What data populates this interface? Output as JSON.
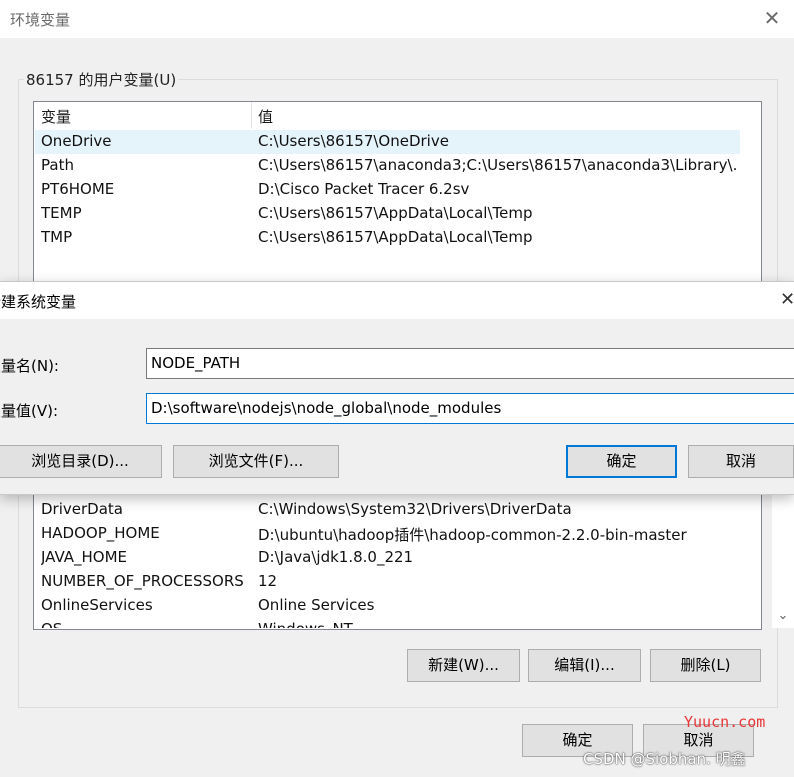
{
  "env_window": {
    "title": "环境变量",
    "close_glyph": "✕",
    "user_group_label": "86157 的用户变量(U)",
    "columns": {
      "name": "变量",
      "value": "值"
    },
    "user_vars": [
      {
        "name": "OneDrive",
        "value": "C:\\Users\\86157\\OneDrive",
        "selected": true
      },
      {
        "name": "Path",
        "value": "C:\\Users\\86157\\anaconda3;C:\\Users\\86157\\anaconda3\\Library\\..."
      },
      {
        "name": "PT6HOME",
        "value": "D:\\Cisco Packet Tracer 6.2sv"
      },
      {
        "name": "TEMP",
        "value": "C:\\Users\\86157\\AppData\\Local\\Temp"
      },
      {
        "name": "TMP",
        "value": "C:\\Users\\86157\\AppData\\Local\\Temp"
      }
    ],
    "system_vars": [
      {
        "name": "DriverData",
        "value": "C:\\Windows\\System32\\Drivers\\DriverData"
      },
      {
        "name": "HADOOP_HOME",
        "value": "D:\\ubuntu\\hadoop插件\\hadoop-common-2.2.0-bin-master"
      },
      {
        "name": "JAVA_HOME",
        "value": "D:\\Java\\jdk1.8.0_221"
      },
      {
        "name": "NUMBER_OF_PROCESSORS",
        "value": "12"
      },
      {
        "name": "OnlineServices",
        "value": "Online Services"
      },
      {
        "name": "OS",
        "value": "Windows_NT"
      }
    ],
    "buttons": {
      "new": "新建(W)...",
      "edit": "编辑(I)...",
      "delete": "删除(L)",
      "ok": "确定",
      "cancel": "取消"
    }
  },
  "new_dialog": {
    "title": "新建系统变量",
    "close_glyph": "✕",
    "name_label": "变量名(N):",
    "name_value": "NODE_PATH",
    "value_label": "变量值(V):",
    "value_value": "D:\\software\\nodejs\\node_global\\node_modules",
    "buttons": {
      "browse_dir": "浏览目录(D)...",
      "browse_file": "浏览文件(F)...",
      "ok": "确定",
      "cancel": "取消"
    }
  },
  "watermarks": {
    "site": "Yuucn.com",
    "csdn": "CSDN @Siobhan. 明鑫"
  },
  "colors": {
    "accent": "#0078d7",
    "selected_row": "#e5f3fb",
    "watermark_red": "#e83535"
  }
}
